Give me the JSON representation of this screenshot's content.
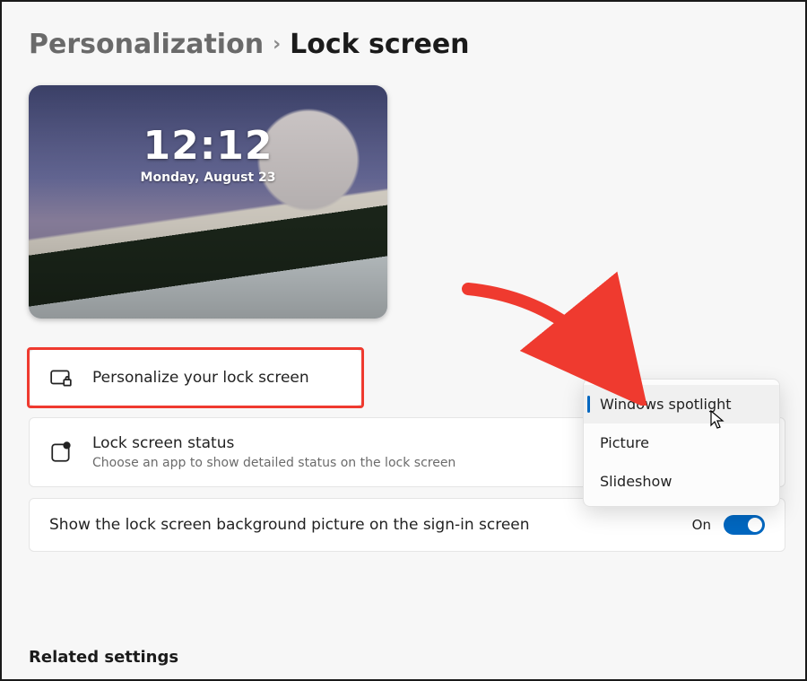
{
  "breadcrumb": {
    "parent": "Personalization",
    "separator": "›",
    "current": "Lock screen"
  },
  "preview": {
    "time": "12:12",
    "date": "Monday, August 23"
  },
  "rows": {
    "personalize": {
      "title": "Personalize your lock screen"
    },
    "status": {
      "title": "Lock screen status",
      "subtitle": "Choose an app to show detailed status on the lock screen"
    },
    "signin": {
      "title": "Show the lock screen background picture on the sign-in screen",
      "toggle_label": "On"
    }
  },
  "dropdown": {
    "options": [
      "Windows spotlight",
      "Picture",
      "Slideshow"
    ],
    "selected_index": 0
  },
  "related_heading": "Related settings",
  "annotation": {
    "arrow_color": "#ef3a2f",
    "highlight_color": "#ef3a2f"
  }
}
